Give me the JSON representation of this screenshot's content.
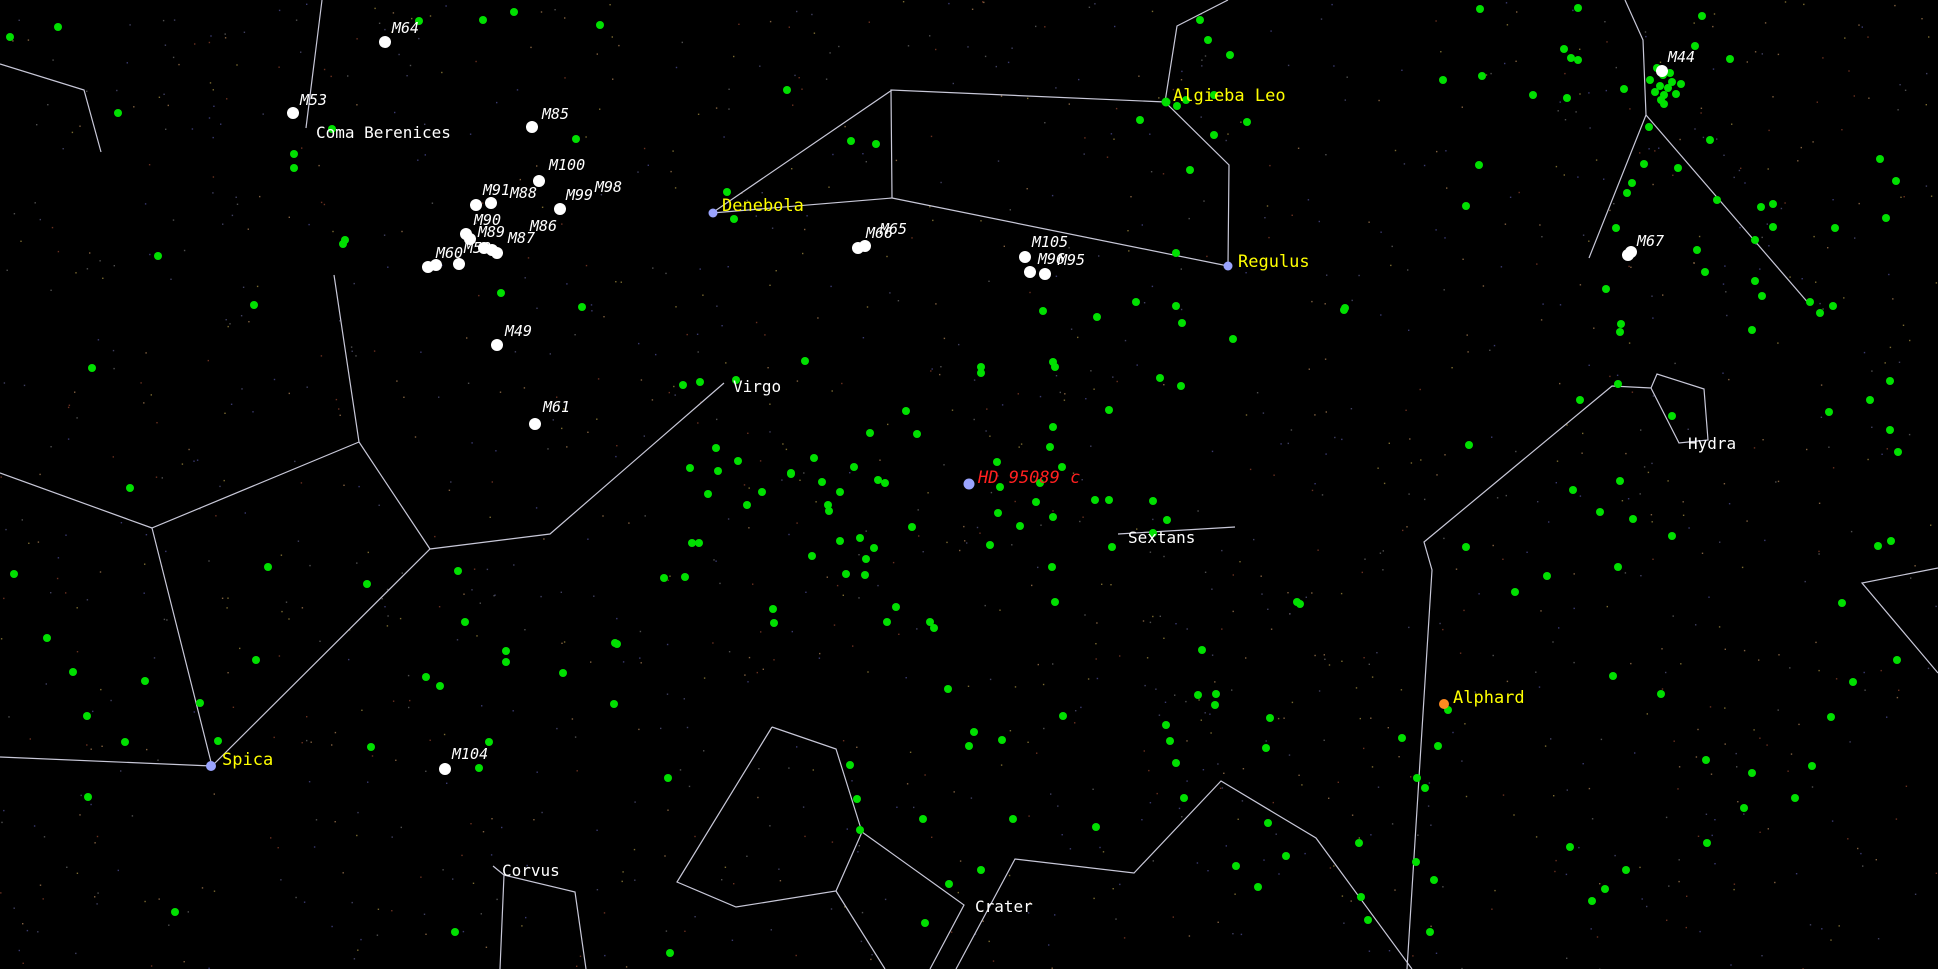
{
  "constellations": [
    "Coma Berenices",
    "Virgo",
    "Sextans",
    "Hydra",
    "Corvus",
    "Crater"
  ],
  "stars": [
    "Denebola",
    "Algieba Leo",
    "Regulus",
    "Spica",
    "Alphard"
  ],
  "deep_sky_objects": [
    "M64",
    "M53",
    "M85",
    "M100",
    "M98",
    "M99",
    "M91",
    "M88",
    "M90",
    "M89",
    "M86",
    "M87",
    "M58",
    "M60",
    "M49",
    "M61",
    "M66",
    "M65",
    "M105",
    "M96",
    "M95",
    "M104",
    "M44",
    "M67"
  ],
  "target": "HD 95089 c",
  "colors": {
    "background": "#000000",
    "constellation_line": "#c8c8d8",
    "field_star": "#00e000",
    "label_star": "#ffff00",
    "label_target": "#ff2020",
    "dso": "#ffffff"
  }
}
